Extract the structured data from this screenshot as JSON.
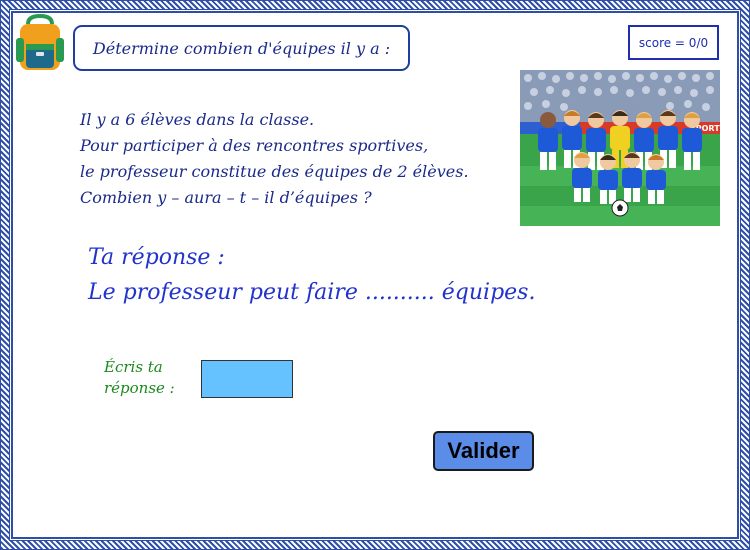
{
  "header": {
    "instruction": "Détermine combien d'équipes il y a :",
    "score": "score = 0/0"
  },
  "problem": {
    "lines": [
      "Il y a 6 élèves dans la classe.",
      "Pour participer à des rencontres sportives,",
      "le professeur constitue des équipes de 2 élèves.",
      "Combien y – aura – t – il d’équipes ?"
    ]
  },
  "answer": {
    "line1": "Ta réponse :",
    "line2": "Le professeur peut faire .......... équipes."
  },
  "input": {
    "prompt_line1": "Écris ta",
    "prompt_line2": "réponse :",
    "value": ""
  },
  "validate_label": "Valider",
  "photo": {
    "subject": "football team photo",
    "banner_text": "SPORT"
  },
  "icons": {
    "backpack": "backpack-icon",
    "ball": "soccer-ball-icon"
  },
  "colors": {
    "frame": "#2e4fa8",
    "instruction_text": "#1a2a8a",
    "answer_text": "#2233cc",
    "prompt_text": "#1a8a1a",
    "input_bg": "#66c2ff",
    "button_bg": "#5b8de8"
  }
}
